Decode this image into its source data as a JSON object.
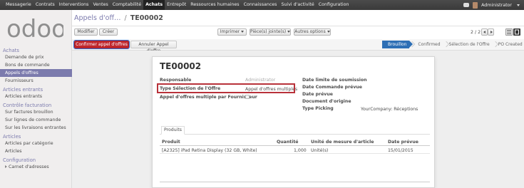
{
  "topmenu": [
    "Messagerie",
    "Contrats",
    "Interventions",
    "Ventes",
    "Comptabilité",
    "Achats",
    "Entrepôt",
    "Ressources humaines",
    "Connaissances",
    "Suivi d'activité",
    "Configuration"
  ],
  "topmenu_active": "Achats",
  "user": {
    "name": "Administrator"
  },
  "logo_text": "odoo",
  "sidebar": {
    "sections": [
      {
        "title": "Achats",
        "items": [
          "Demande de prix",
          "Bons de commande",
          "Appels d'offres",
          "Fournisseurs"
        ]
      },
      {
        "title": "Articles entrants",
        "items": [
          "Articles entrants"
        ]
      },
      {
        "title": "Contrôle facturation",
        "items": [
          "Sur factures brouillon",
          "Sur lignes de commande",
          "Sur les livraisons entrantes"
        ]
      },
      {
        "title": "Articles",
        "items": [
          "Articles par catégorie",
          "Articles"
        ]
      },
      {
        "title": "Configuration",
        "items": [
          "Carnet d'adresses"
        ]
      }
    ],
    "active_item": "Appels d'offres"
  },
  "breadcrumb": {
    "parent": "Appels d'off…",
    "separator": "/",
    "current": "TE00002"
  },
  "buttons": {
    "edit": "Modifier",
    "create": "Créer",
    "print": "Imprimer",
    "attachments": "Pièce(s) jointe(s)",
    "more": "Autres options",
    "confirm": "Confirmer appel d'offres",
    "cancel": "Annuler Appel d'offre"
  },
  "pager": "2 / 2",
  "statusbar": [
    "Brouillon",
    "Confirmed",
    "Sélection de l'Offre",
    "PO Created"
  ],
  "statusbar_current": "Brouillon",
  "record": {
    "title": "TE00002",
    "left_fields": [
      {
        "label": "Responsable",
        "value": "Administrator"
      },
      {
        "label": "Type Sélection de l'Offre",
        "value": "Appel d'offres multiples"
      },
      {
        "label": "Appel d'offres multiple par Fournisseur",
        "value": ""
      }
    ],
    "right_fields": [
      {
        "label": "Date limite de soumission",
        "value": ""
      },
      {
        "label": "Date Commande prévue",
        "value": ""
      },
      {
        "label": "Date prévue",
        "value": ""
      },
      {
        "label": "Document d'origine",
        "value": ""
      },
      {
        "label": "Type Picking",
        "value": "YourCompany: Réceptions"
      }
    ]
  },
  "tab": "Produits",
  "table": {
    "headers": [
      "Produit",
      "Quantité",
      "Unité de mesure d'article",
      "Date prévue"
    ],
    "rows": [
      [
        "[A2325] iPad Retina Display (32 GB, White)",
        "1,000",
        "Unité(s)",
        "15/01/2015"
      ]
    ]
  }
}
